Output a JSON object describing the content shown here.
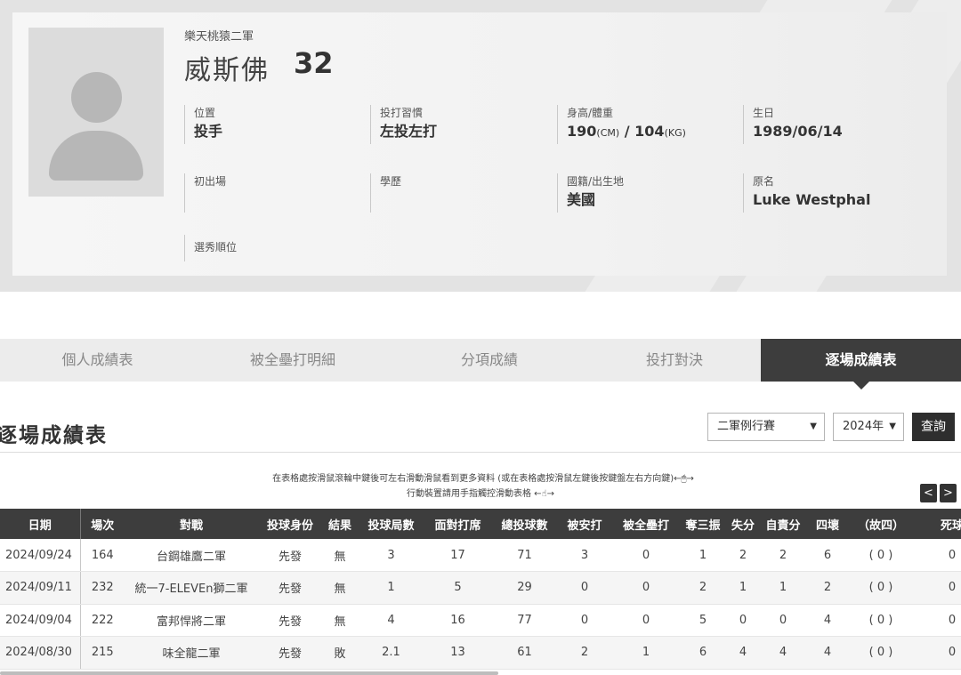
{
  "player": {
    "team": "樂天桃猿二軍",
    "name": "威斯佛",
    "number": "32",
    "fields": {
      "position_label": "位置",
      "position": "投手",
      "habit_label": "投打習慣",
      "habit": "左投左打",
      "hw_label": "身高/體重",
      "height": "190",
      "height_unit": "(CM)",
      "weight": "104",
      "weight_unit": "(KG)",
      "hw_sep": " / ",
      "birthday_label": "生日",
      "birthday": "1989/06/14",
      "debut_label": "初出場",
      "debut": "",
      "education_label": "學歷",
      "education": "",
      "nationality_label": "國籍/出生地",
      "nationality": "美國",
      "original_name_label": "原名",
      "original_name": "Luke Westphal",
      "draft_label": "選秀順位",
      "draft": ""
    }
  },
  "tabs": [
    "個人成績表",
    "被全壘打明細",
    "分項成績",
    "投打對決",
    "逐場成績表"
  ],
  "active_tab_index": 4,
  "section": {
    "title": "逐場成績表",
    "game_type": "二軍例行賽",
    "year": "2024年",
    "query_label": "查詢",
    "hint_line1": "在表格處按滑鼠滾輪中鍵後可左右滑動滑鼠看到更多資料 (或在表格處按滑鼠左鍵後按鍵盤左右方向鍵)←🖱→",
    "hint_line2": "行動裝置請用手指觸控滑動表格 ←☝→",
    "prev": "<",
    "next": ">"
  },
  "table": {
    "headers": [
      "日期",
      "場次",
      "對戰",
      "投球身份",
      "結果",
      "投球局數",
      "面對打席",
      "總投球數",
      "被安打",
      "被全壘打",
      "奪三振",
      "失分",
      "自責分",
      "四壞",
      "（故四）",
      "死球"
    ],
    "rows": [
      [
        "2024/09/24",
        "164",
        "台鋼雄鷹二軍",
        "先發",
        "無",
        "3",
        "17",
        "71",
        "3",
        "0",
        "1",
        "2",
        "2",
        "6",
        "( 0 )",
        "0"
      ],
      [
        "2024/09/11",
        "232",
        "統一7-ELEVEn獅二軍",
        "先發",
        "無",
        "1",
        "5",
        "29",
        "0",
        "0",
        "2",
        "1",
        "1",
        "2",
        "( 0 )",
        "0"
      ],
      [
        "2024/09/04",
        "222",
        "富邦悍將二軍",
        "先發",
        "無",
        "4",
        "16",
        "77",
        "0",
        "0",
        "5",
        "0",
        "0",
        "4",
        "( 0 )",
        "0"
      ],
      [
        "2024/08/30",
        "215",
        "味全龍二軍",
        "先發",
        "敗",
        "2.1",
        "13",
        "61",
        "2",
        "1",
        "6",
        "4",
        "4",
        "4",
        "( 0 )",
        "0"
      ]
    ]
  }
}
